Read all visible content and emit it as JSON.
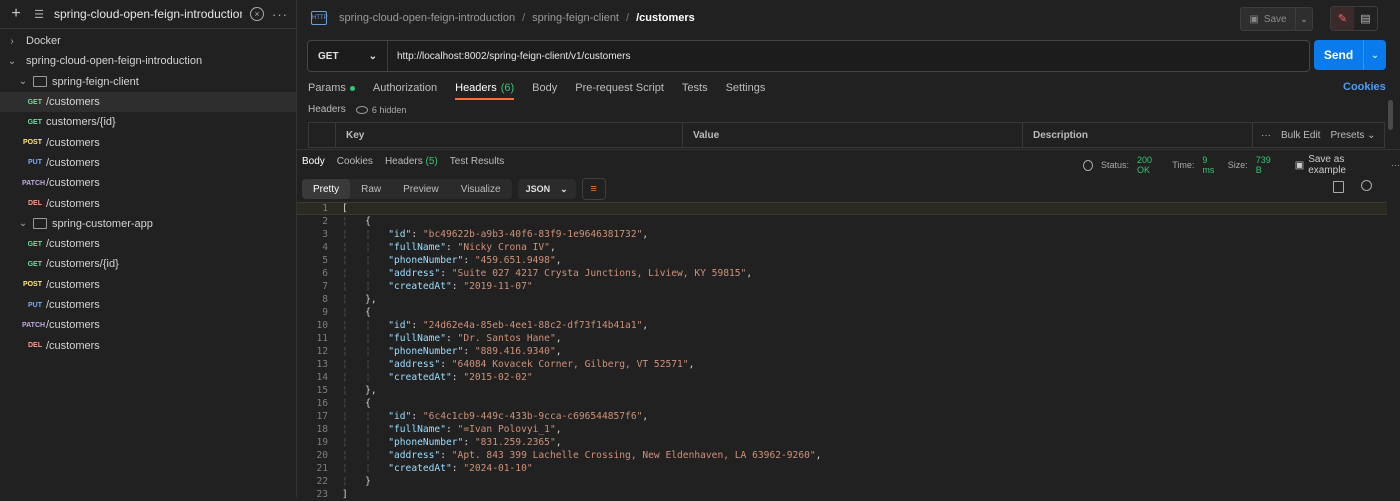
{
  "sidebar": {
    "search_value": "spring-cloud-open-feign-introduction",
    "tree": [
      {
        "type": "collection",
        "label": "Docker",
        "expanded": false
      },
      {
        "type": "collection",
        "label": "spring-cloud-open-feign-introduction",
        "expanded": true
      },
      {
        "type": "folder",
        "label": "spring-feign-client"
      },
      {
        "type": "request",
        "method": "GET",
        "label": "/customers",
        "selected": true
      },
      {
        "type": "request",
        "method": "GET",
        "label": "customers/{id}"
      },
      {
        "type": "request",
        "method": "POST",
        "label": "/customers"
      },
      {
        "type": "request",
        "method": "PUT",
        "label": "/customers"
      },
      {
        "type": "request",
        "method": "PATCH",
        "label": "/customers"
      },
      {
        "type": "request",
        "method": "DEL",
        "label": "/customers"
      },
      {
        "type": "folder",
        "label": "spring-customer-app"
      },
      {
        "type": "request",
        "method": "GET",
        "label": "/customers"
      },
      {
        "type": "request",
        "method": "GET",
        "label": "/customers/{id}"
      },
      {
        "type": "request",
        "method": "POST",
        "label": "/customers"
      },
      {
        "type": "request",
        "method": "PUT",
        "label": "/customers"
      },
      {
        "type": "request",
        "method": "PATCH",
        "label": "/customers"
      },
      {
        "type": "request",
        "method": "DEL",
        "label": "/customers"
      }
    ]
  },
  "header": {
    "breadcrumb": [
      "spring-cloud-open-feign-introduction",
      "spring-feign-client"
    ],
    "current": "/customers",
    "save_label": "Save"
  },
  "request": {
    "method": "GET",
    "url": "http://localhost:8002/spring-feign-client/v1/customers",
    "send_label": "Send",
    "tabs": {
      "params": "Params",
      "authorization": "Authorization",
      "headers": "Headers",
      "headers_count": "(6)",
      "body": "Body",
      "prerequest": "Pre-request Script",
      "tests": "Tests",
      "settings": "Settings"
    },
    "cookies_label": "Cookies",
    "headers_label": "Headers",
    "hidden_label": "6 hidden",
    "table": {
      "key": "Key",
      "value": "Value",
      "description": "Description",
      "bulk_edit": "Bulk Edit",
      "presets": "Presets"
    }
  },
  "response": {
    "tabs": {
      "body": "Body",
      "cookies": "Cookies",
      "headers": "Headers",
      "headers_count": "(5)",
      "test_results": "Test Results"
    },
    "status_label": "Status:",
    "status_value": "200 OK",
    "time_label": "Time:",
    "time_value": "9 ms",
    "size_label": "Size:",
    "size_value": "739 B",
    "save_example": "Save as example",
    "view_tabs": {
      "pretty": "Pretty",
      "raw": "Raw",
      "preview": "Preview",
      "visualize": "Visualize"
    },
    "format": "JSON",
    "code_lines": [
      {
        "n": "1",
        "indent": 0,
        "kind": "punct",
        "text": "["
      },
      {
        "n": "2",
        "indent": 1,
        "kind": "punct",
        "text": "{"
      },
      {
        "n": "3",
        "indent": 2,
        "kind": "pair",
        "key": "\"id\"",
        "value": "\"bc49622b-a9b3-40f6-83f9-1e9646381732\"",
        "end": ","
      },
      {
        "n": "4",
        "indent": 2,
        "kind": "pair",
        "key": "\"fullName\"",
        "value": "\"Nicky Crona IV\"",
        "end": ","
      },
      {
        "n": "5",
        "indent": 2,
        "kind": "pair",
        "key": "\"phoneNumber\"",
        "value": "\"459.651.9498\"",
        "end": ","
      },
      {
        "n": "6",
        "indent": 2,
        "kind": "pair",
        "key": "\"address\"",
        "value": "\"Suite 027 4217 Crysta Junctions, Liview, KY 59815\"",
        "end": ","
      },
      {
        "n": "7",
        "indent": 2,
        "kind": "pair",
        "key": "\"createdAt\"",
        "value": "\"2019-11-07\"",
        "end": ""
      },
      {
        "n": "8",
        "indent": 1,
        "kind": "punct",
        "text": "},"
      },
      {
        "n": "9",
        "indent": 1,
        "kind": "punct",
        "text": "{"
      },
      {
        "n": "10",
        "indent": 2,
        "kind": "pair",
        "key": "\"id\"",
        "value": "\"24d62e4a-85eb-4ee1-88c2-df73f14b41a1\"",
        "end": ","
      },
      {
        "n": "11",
        "indent": 2,
        "kind": "pair",
        "key": "\"fullName\"",
        "value": "\"Dr. Santos Hane\"",
        "end": ","
      },
      {
        "n": "12",
        "indent": 2,
        "kind": "pair",
        "key": "\"phoneNumber\"",
        "value": "\"889.416.9340\"",
        "end": ","
      },
      {
        "n": "13",
        "indent": 2,
        "kind": "pair",
        "key": "\"address\"",
        "value": "\"64084 Kovacek Corner, Gilberg, VT 52571\"",
        "end": ","
      },
      {
        "n": "14",
        "indent": 2,
        "kind": "pair",
        "key": "\"createdAt\"",
        "value": "\"2015-02-02\"",
        "end": ""
      },
      {
        "n": "15",
        "indent": 1,
        "kind": "punct",
        "text": "},"
      },
      {
        "n": "16",
        "indent": 1,
        "kind": "punct",
        "text": "{"
      },
      {
        "n": "17",
        "indent": 2,
        "kind": "pair",
        "key": "\"id\"",
        "value": "\"6c4c1cb9-449c-433b-9cca-c696544857f6\"",
        "end": ","
      },
      {
        "n": "18",
        "indent": 2,
        "kind": "pair",
        "key": "\"fullName\"",
        "value": "\"=Ivan Polovyi_1\"",
        "end": ","
      },
      {
        "n": "19",
        "indent": 2,
        "kind": "pair",
        "key": "\"phoneNumber\"",
        "value": "\"831.259.2365\"",
        "end": ","
      },
      {
        "n": "20",
        "indent": 2,
        "kind": "pair",
        "key": "\"address\"",
        "value": "\"Apt. 843 399 Lachelle Crossing, New Eldenhaven, LA 63962-9260\"",
        "end": ","
      },
      {
        "n": "21",
        "indent": 2,
        "kind": "pair",
        "key": "\"createdAt\"",
        "value": "\"2024-01-10\"",
        "end": ""
      },
      {
        "n": "22",
        "indent": 1,
        "kind": "punct",
        "text": "}"
      },
      {
        "n": "23",
        "indent": 0,
        "kind": "punct",
        "text": "]"
      }
    ]
  },
  "colors": {
    "accent": "#ff6c37",
    "send": "#097bed",
    "status_ok": "#34c671"
  }
}
